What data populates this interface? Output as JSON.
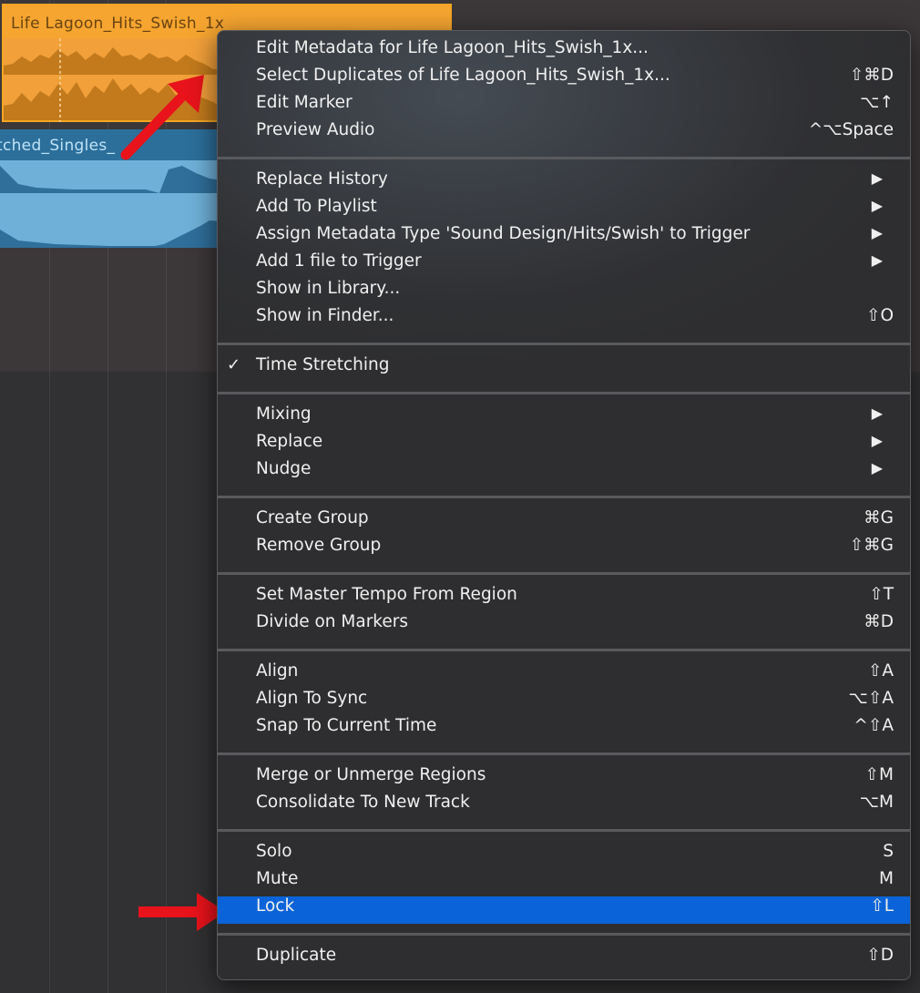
{
  "regions": {
    "orange_title": "Life Lagoon_Hits_Swish_1x",
    "blue_title": "tched_Singles_"
  },
  "colors": {
    "menu_bg": "#2e2e30",
    "highlight": "#0a63d8",
    "orange_region": "#f2a03a",
    "blue_region": "#6fb0d8",
    "arrow": "#e8131b"
  },
  "menu": {
    "groups": [
      [
        {
          "label": "Edit Metadata for Life Lagoon_Hits_Swish_1x...",
          "shortcut": ""
        },
        {
          "label": "Select Duplicates of Life Lagoon_Hits_Swish_1x...",
          "shortcut": "⇧⌘D"
        },
        {
          "label": "Edit Marker",
          "shortcut": "⌥↑"
        },
        {
          "label": "Preview Audio",
          "shortcut": "^⌥Space"
        }
      ],
      [
        {
          "label": "Replace History",
          "submenu": true
        },
        {
          "label": "Add To Playlist",
          "submenu": true
        },
        {
          "label": "Assign Metadata Type 'Sound Design/Hits/Swish' to Trigger",
          "submenu": true
        },
        {
          "label": "Add 1 file to Trigger",
          "submenu": true
        },
        {
          "label": "Show in Library...",
          "shortcut": ""
        },
        {
          "label": "Show in Finder...",
          "shortcut": "⇧O"
        }
      ],
      [
        {
          "label": "Time Stretching",
          "checked": true
        }
      ],
      [
        {
          "label": "Mixing",
          "submenu": true
        },
        {
          "label": "Replace",
          "submenu": true
        },
        {
          "label": "Nudge",
          "submenu": true
        }
      ],
      [
        {
          "label": "Create Group",
          "shortcut": "⌘G"
        },
        {
          "label": "Remove Group",
          "shortcut": "⇧⌘G"
        }
      ],
      [
        {
          "label": "Set Master Tempo From Region",
          "shortcut": "⇧T"
        },
        {
          "label": "Divide on Markers",
          "shortcut": "⌘D"
        }
      ],
      [
        {
          "label": "Align",
          "shortcut": "⇧A"
        },
        {
          "label": "Align To Sync",
          "shortcut": "⌥⇧A"
        },
        {
          "label": "Snap To Current Time",
          "shortcut": "^⇧A"
        }
      ],
      [
        {
          "label": "Merge or Unmerge Regions",
          "shortcut": "⇧M"
        },
        {
          "label": "Consolidate To New Track",
          "shortcut": "⌥M"
        }
      ],
      [
        {
          "label": "Solo",
          "shortcut": "S"
        },
        {
          "label": "Mute",
          "shortcut": "M"
        },
        {
          "label": "Lock",
          "shortcut": "⇧L",
          "highlighted": true
        }
      ],
      [
        {
          "label": "Duplicate",
          "shortcut": "⇧D"
        }
      ]
    ]
  }
}
